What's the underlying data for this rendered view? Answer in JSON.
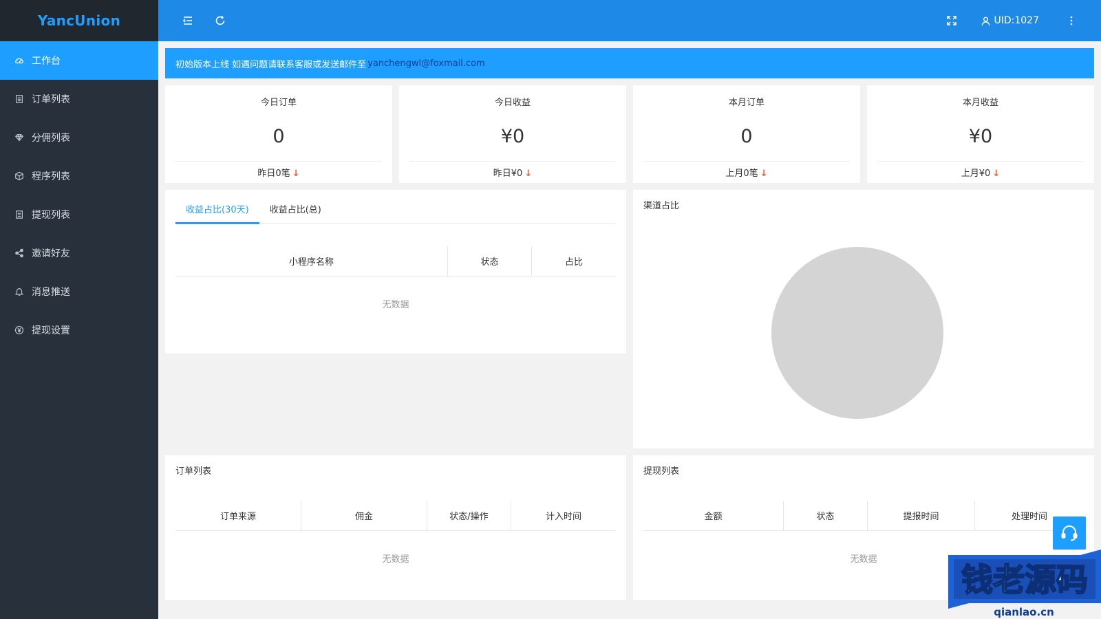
{
  "app": {
    "logo": "YancUnion"
  },
  "sidebar": {
    "items": [
      {
        "label": "工作台",
        "icon": "dashboard-icon"
      },
      {
        "label": "订单列表",
        "icon": "document-icon"
      },
      {
        "label": "分佣列表",
        "icon": "diamond-icon"
      },
      {
        "label": "程序列表",
        "icon": "cube-icon"
      },
      {
        "label": "提现列表",
        "icon": "document-icon"
      },
      {
        "label": "邀请好友",
        "icon": "share-icon"
      },
      {
        "label": "消息推送",
        "icon": "bell-icon"
      },
      {
        "label": "提现设置",
        "icon": "yen-circle-icon"
      }
    ]
  },
  "header": {
    "uid": "UID:1027"
  },
  "notice": {
    "text": "初始版本上线 如遇问题请联系客服或发送邮件至",
    "email": "yanchengwl@foxmail.com"
  },
  "stats": [
    {
      "title": "今日订单",
      "value": "0",
      "foot": "昨日0笔",
      "arrow": "↓"
    },
    {
      "title": "今日收益",
      "value": "¥0",
      "foot": "昨日¥0",
      "arrow": "↓"
    },
    {
      "title": "本月订单",
      "value": "0",
      "foot": "上月0笔",
      "arrow": "↓"
    },
    {
      "title": "本月收益",
      "value": "¥0",
      "foot": "上月¥0",
      "arrow": "↓"
    }
  ],
  "revenue_panel": {
    "tabs": [
      "收益占比(30天)",
      "收益占比(总)"
    ],
    "columns": [
      "小程序名称",
      "状态",
      "占比"
    ],
    "empty": "无数据"
  },
  "channel_panel": {
    "title": "渠道占比"
  },
  "orders_panel": {
    "title": "订单列表",
    "columns": [
      "订单来源",
      "佣金",
      "状态/操作",
      "计入时间"
    ],
    "empty": "无数据"
  },
  "withdraw_panel": {
    "title": "提现列表",
    "columns": [
      "金额",
      "状态",
      "提报时间",
      "处理时间"
    ],
    "empty": "无数据"
  },
  "watermark": {
    "main": "钱老源码",
    "site": "qianlao.cn"
  },
  "colors": {
    "primary": "#1e9fff",
    "header": "#1e89e6",
    "sidebar": "#28313b",
    "down_arrow": "#ff5722",
    "pie_empty": "#d4d4d4"
  }
}
